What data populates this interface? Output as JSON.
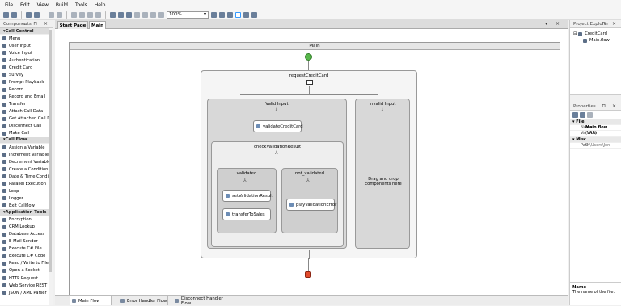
{
  "menu": [
    "File",
    "Edit",
    "View",
    "Build",
    "Tools",
    "Help"
  ],
  "toolbar": {
    "zoom": "100%"
  },
  "components_panel": {
    "title": "Components",
    "groups": [
      {
        "name": "Call Control",
        "items": [
          "Menu",
          "User Input",
          "Voice Input",
          "Authentication",
          "Credit Card",
          "Survey",
          "Prompt Playback",
          "Record",
          "Record and Email",
          "Transfer",
          "Attach Call Data",
          "Get Attached Call D",
          "Disconnect Call",
          "Make Call"
        ]
      },
      {
        "name": "Call Flow",
        "items": [
          "Assign a Variable",
          "Increment Variable",
          "Decrement Variable",
          "Create a Condition",
          "Date & Time Condit",
          "Parallel Execution",
          "Loop",
          "Logger",
          "Exit Callflow"
        ]
      },
      {
        "name": "Application Tools",
        "items": [
          "Encryption",
          "CRM Lookup",
          "Database Access",
          "E-Mail Sender",
          "Execute C# File",
          "Execute C# Code",
          "Read / Write to File",
          "Open a Socket",
          "HTTP Request",
          "Web Service REST",
          "JSON / XML Parser"
        ]
      }
    ]
  },
  "doc_tabs": [
    {
      "label": "Start Page",
      "active": false
    },
    {
      "label": "Main",
      "active": true
    }
  ],
  "flow": {
    "main_title": "Main",
    "credit_card_title": "requestCreditCard",
    "valid_input": "Valid Input",
    "invalid_input": "Invalid Input",
    "validate_node": "validateCreditCard",
    "check_title": "checkValidationResult",
    "validated": "validated",
    "not_validated": "not_validated",
    "set_node": "setValidationResult",
    "transfer_node": "transferToSales",
    "play_node": "playValidationError",
    "drag_hint": "Drag and drop components here"
  },
  "bottom_tabs": [
    {
      "label": "Main Flow"
    },
    {
      "label": "Error Handler Flow"
    },
    {
      "label": "Disconnect Handler Flow"
    }
  ],
  "project_explorer": {
    "title": "Project Explorer",
    "project": "CreditCard",
    "file": "Main.flow"
  },
  "properties": {
    "title": "Properties",
    "section1": "File",
    "rows1": [
      {
        "k": "Name",
        "v": "Main.flow"
      },
      {
        "k": "Variable",
        "v": "(VAR)"
      }
    ],
    "section2": "Misc",
    "rows2": [
      {
        "k": "Path",
        "v": "C:\\Users\\Jon"
      }
    ],
    "desc_title": "Name",
    "desc_text": "The name of the file."
  }
}
